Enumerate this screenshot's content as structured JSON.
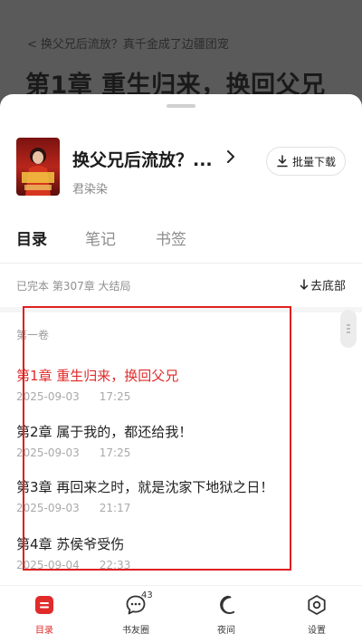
{
  "reader": {
    "breadcrumb": "换父兄后流放？真千金成了边疆团宠",
    "chapter_heading": "第1章 重生归来，换回父兄"
  },
  "book": {
    "title": "换父兄后流放？...",
    "author": "君染染",
    "batch_download_label": "批量下载"
  },
  "tabs": [
    {
      "label": "目录",
      "active": true
    },
    {
      "label": "笔记",
      "active": false
    },
    {
      "label": "书签",
      "active": false
    }
  ],
  "status": {
    "text": "已完本 第307章 大结局",
    "goto_bottom_label": "去底部"
  },
  "volume_label": "第一卷",
  "chapters": [
    {
      "title": "第1章 重生归来，换回父兄",
      "date": "2025-09-03",
      "time": "17:25",
      "current": true
    },
    {
      "title": "第2章 属于我的，都还给我！",
      "date": "2025-09-03",
      "time": "17:25",
      "current": false
    },
    {
      "title": "第3章 再回来之时，就是沈家下地狱之日！",
      "date": "2025-09-03",
      "time": "21:17",
      "current": false
    },
    {
      "title": "第4章 苏侯爷受伤",
      "date": "2025-09-04",
      "time": "22:33",
      "current": false
    }
  ],
  "bottom_nav": [
    {
      "label": "目录",
      "icon": "catalog-icon",
      "active": true
    },
    {
      "label": "书友圈",
      "icon": "chat-bubble-icon",
      "badge": "43",
      "active": false
    },
    {
      "label": "夜间",
      "icon": "moon-icon",
      "active": false
    },
    {
      "label": "设置",
      "icon": "settings-icon",
      "active": false
    }
  ],
  "colors": {
    "accent": "#e02b2b",
    "overlay": "#5a5a5a",
    "highlight_box": "#e02020"
  }
}
